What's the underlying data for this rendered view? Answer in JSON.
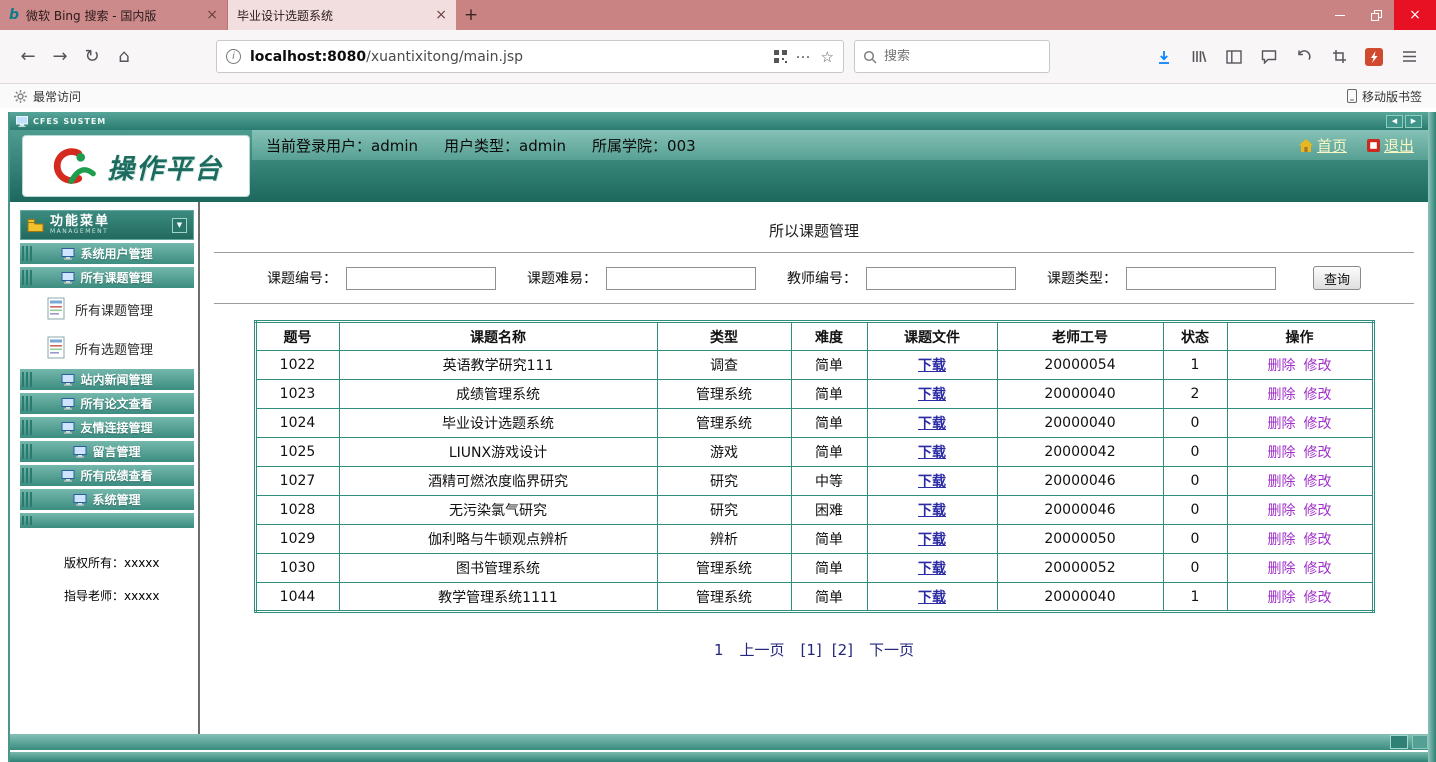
{
  "colors": {
    "chrome_bar": "#c98383",
    "active_tab": "#f2dede",
    "close_button": "#e81123",
    "teal_dark": "#1c685d",
    "teal_mid": "#3c8c80",
    "teal_light": "#74b7ac",
    "table_border": "#2f8e7e",
    "download_link": "#2b2ba6",
    "action_link": "#a02fc9",
    "pagination_link": "#26267e",
    "header_link": "#f9f6c6",
    "download_icon": "#0a84ff",
    "flash_icon": "#cf4a2e"
  },
  "browser": {
    "tabs": [
      {
        "title": "微软 Bing 搜索 - 国内版"
      },
      {
        "title": "毕业设计选题系统"
      }
    ],
    "new_tab": "+",
    "url_host": "localhost:8080",
    "url_path": "/xuantixitong/main.jsp",
    "search_placeholder": "搜索",
    "bookmarks_left": "最常访问",
    "bookmarks_right": "移动版书签"
  },
  "page": {
    "window_title": "CFES SUSTEM",
    "header": {
      "logo_text": "操作平台",
      "user_info": [
        "当前登录用户：admin",
        "用户类型：admin",
        "所属学院：003"
      ],
      "home_link": "首页",
      "logout_link": "退出"
    },
    "sidebar": {
      "menu_title": "功能菜单",
      "menu_subtitle": "MANAGEMENT",
      "items": [
        {
          "label": "系统用户管理",
          "style": "teal"
        },
        {
          "label": "所有课题管理",
          "style": "teal"
        },
        {
          "label": "所有课题管理",
          "style": "white"
        },
        {
          "label": "所有选题管理",
          "style": "white"
        },
        {
          "label": "站内新闻管理",
          "style": "teal"
        },
        {
          "label": "所有论文查看",
          "style": "teal"
        },
        {
          "label": "友情连接管理",
          "style": "teal"
        },
        {
          "label": "留言管理",
          "style": "teal"
        },
        {
          "label": "所有成绩查看",
          "style": "teal"
        },
        {
          "label": "系统管理",
          "style": "teal"
        }
      ],
      "copyright": "版权所有：xxxxx",
      "advisor": "指导老师：xxxxx"
    },
    "main": {
      "title": "所以课题管理",
      "form": {
        "labels": [
          "课题编号：",
          "课题难易：",
          "教师编号：",
          "课题类型："
        ],
        "submit": "查询"
      },
      "table": {
        "headers": [
          "题号",
          "课题名称",
          "类型",
          "难度",
          "课题文件",
          "老师工号",
          "状态",
          "操作"
        ],
        "download_label": "下载",
        "delete_label": "删除",
        "edit_label": "修改",
        "rows": [
          {
            "no": "1022",
            "name": "英语教学研究111",
            "type": "调查",
            "level": "简单",
            "teacher": "20000054",
            "status": "1"
          },
          {
            "no": "1023",
            "name": "成绩管理系统",
            "type": "管理系统",
            "level": "简单",
            "teacher": "20000040",
            "status": "2"
          },
          {
            "no": "1024",
            "name": "毕业设计选题系统",
            "type": "管理系统",
            "level": "简单",
            "teacher": "20000040",
            "status": "0"
          },
          {
            "no": "1025",
            "name": "LIUNX游戏设计",
            "type": "游戏",
            "level": "简单",
            "teacher": "20000042",
            "status": "0"
          },
          {
            "no": "1027",
            "name": "酒精可燃浓度临界研究",
            "type": "研究",
            "level": "中等",
            "teacher": "20000046",
            "status": "0"
          },
          {
            "no": "1028",
            "name": "无污染氯气研究",
            "type": "研究",
            "level": "困难",
            "teacher": "20000046",
            "status": "0"
          },
          {
            "no": "1029",
            "name": "伽利略与牛顿观点辨析",
            "type": "辨析",
            "level": "简单",
            "teacher": "20000050",
            "status": "0"
          },
          {
            "no": "1030",
            "name": "图书管理系统",
            "type": "管理系统",
            "level": "简单",
            "teacher": "20000052",
            "status": "0"
          },
          {
            "no": "1044",
            "name": "教学管理系统1111",
            "type": "管理系统",
            "level": "简单",
            "teacher": "20000040",
            "status": "1"
          }
        ]
      },
      "pagination": {
        "current": "1",
        "prev": "上一页",
        "page1": "[1]",
        "page2": "[2]",
        "next": "下一页"
      }
    }
  }
}
